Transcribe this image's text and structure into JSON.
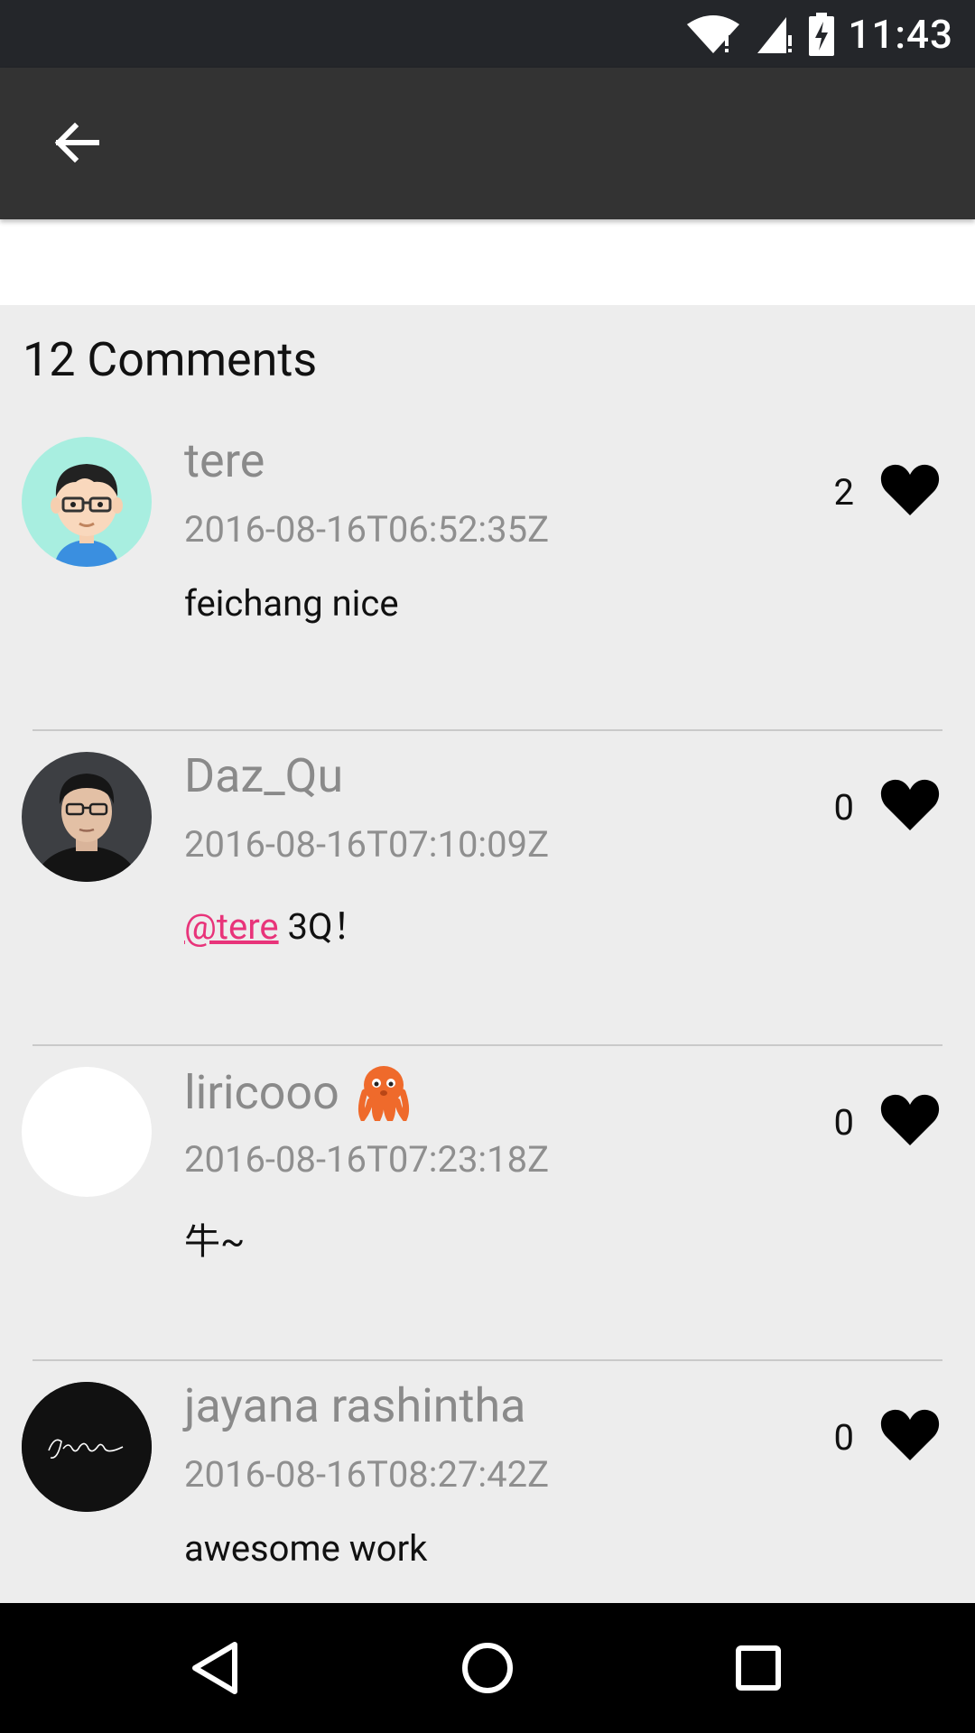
{
  "status_bar": {
    "time": "11:43"
  },
  "toolbar": {
    "back_icon": "arrow-left-icon"
  },
  "comments_header": "12 Comments",
  "comments": [
    {
      "username": "tere",
      "timestamp": "2016-08-16T06:52:35Z",
      "mention": "",
      "text": "feichang nice",
      "likes": "2"
    },
    {
      "username": "Daz_Qu",
      "timestamp": "2016-08-16T07:10:09Z",
      "mention": "@tere",
      "text": " 3Q！",
      "likes": "0"
    },
    {
      "username": "liricooo",
      "username_emoji": "octopus-icon",
      "timestamp": "2016-08-16T07:23:18Z",
      "mention": "",
      "text": "牛~",
      "likes": "0"
    },
    {
      "username": "jayana rashintha",
      "timestamp": "2016-08-16T08:27:42Z",
      "mention": "",
      "text": "awesome work",
      "likes": "0"
    }
  ],
  "colors": {
    "status_bar": "#24262a",
    "toolbar": "#333333",
    "background": "#ededed",
    "mention": "#e8347a",
    "username": "#8a8a8a"
  }
}
